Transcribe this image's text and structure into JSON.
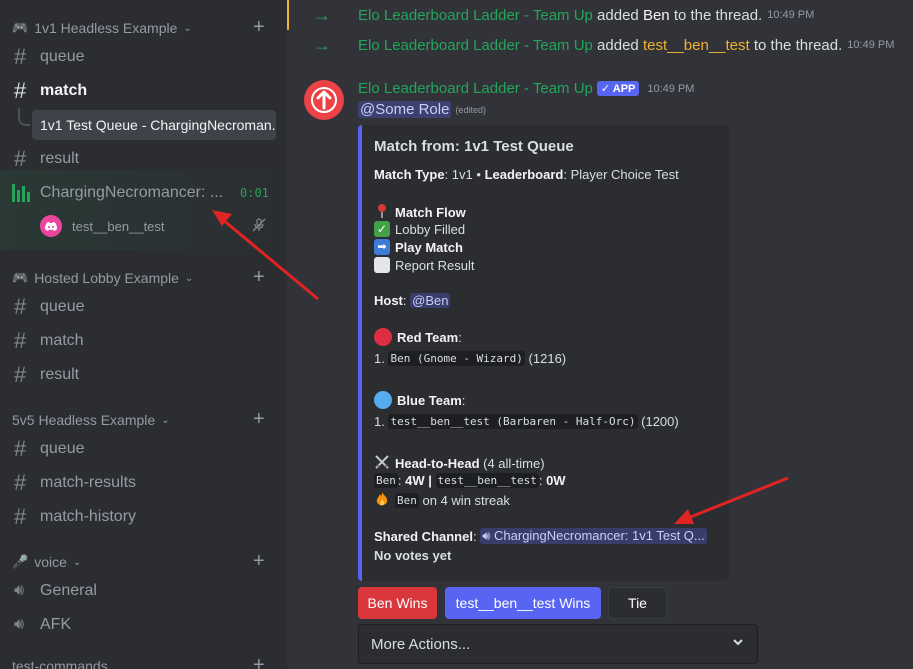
{
  "sidebar": {
    "categories": [
      {
        "emoji": "🎮",
        "label": "1v1 Headless Example"
      },
      {
        "emoji": "🎮",
        "label": "Hosted Lobby Example"
      },
      {
        "emoji": "",
        "label": "5v5 Headless Example"
      },
      {
        "emoji": "🎤",
        "label": "voice"
      },
      {
        "emoji": "",
        "label": "test-commands"
      }
    ],
    "channels": {
      "queue1": "queue",
      "match1": "match",
      "thread": "1v1 Test Queue - ChargingNecroman...",
      "result1": "result",
      "voice_channel": "ChargingNecromancer: ...",
      "voice_timer": "0:01",
      "voice_user": "test__ben__test",
      "queue2": "queue",
      "match2": "match",
      "result2": "result",
      "queue3": "queue",
      "match_results": "match-results",
      "match_history": "match-history",
      "general": "General",
      "afk": "AFK"
    }
  },
  "main": {
    "sys1": {
      "author": "Elo Leaderboard Ladder - Team Up",
      "verb": "added",
      "user": "Ben",
      "suffix": "to the thread.",
      "time": "10:49 PM"
    },
    "sys2": {
      "author": "Elo Leaderboard Ladder - Team Up",
      "verb": "added",
      "user": "test__ben__test",
      "suffix": "to the thread.",
      "time": "10:49 PM"
    },
    "message": {
      "author": "Elo Leaderboard Ladder - Team Up",
      "badge": "APP",
      "time": "10:49 PM",
      "role_mention": "@Some Role",
      "edited": "(edited)"
    },
    "embed": {
      "title": "Match from: 1v1 Test Queue",
      "match_type_label": "Match Type",
      "match_type": "1v1",
      "bullet": "•",
      "leaderboard_label": "Leaderboard",
      "leaderboard": "Player Choice Test",
      "flow_title": "Match Flow",
      "flow_1": "Lobby Filled",
      "flow_2": "Play Match",
      "flow_3": "Report Result",
      "host_label": "Host",
      "host": "@Ben",
      "red_team": "Red Team",
      "red_num": "1.",
      "red_player": "Ben (Gnome - Wizard)",
      "red_rating": "(1216)",
      "blue_team": "Blue Team",
      "blue_num": "1.",
      "blue_player": "test__ben__test (Barbaren - Half-Orc)",
      "blue_rating": "(1200)",
      "h2h_title": "Head-to-Head",
      "h2h_count": "(4 all-time)",
      "p1": "Ben",
      "p1_record": "4W",
      "sep": "|",
      "p2": "test__ben__test",
      "p2_record": "0W",
      "streak_user": "Ben",
      "streak_text": "on 4 win streak",
      "shared_label": "Shared Channel",
      "shared_channel": "ChargingNecromancer: 1v1 Test Q...",
      "votes": "No votes yet"
    },
    "buttons": {
      "ben_wins": "Ben Wins",
      "test_wins": "test__ben__test Wins",
      "tie": "Tie"
    },
    "select": {
      "placeholder": "More Actions..."
    }
  },
  "colors": {
    "accent": "#5865f2",
    "green": "#23a55a",
    "red": "#da373c",
    "annotation": "#e02424"
  }
}
